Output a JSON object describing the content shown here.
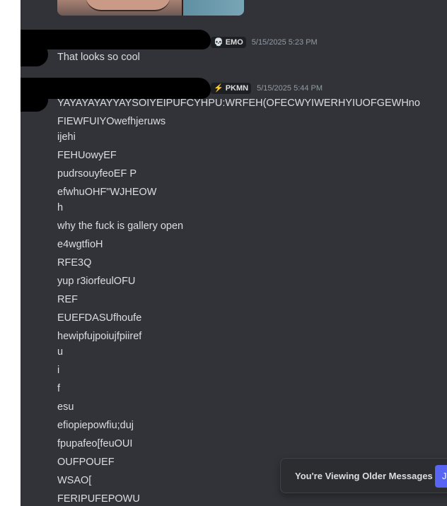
{
  "messages": [
    {
      "role_badge": {
        "icon": "skull-icon",
        "icon_glyph": "💀",
        "label": "EMO"
      },
      "timestamp": "5/15/2025 5:23 PM",
      "lines": [
        "That looks so cool"
      ]
    },
    {
      "role_badge": {
        "icon": "lightning-icon",
        "icon_glyph": "⚡",
        "label": "PKMN"
      },
      "timestamp": "5/15/2025 5:44 PM",
      "lines": [
        "YAYAYAYAYYAYSOIYEIPUFCYHPU:WRFEH(OFECWYIWERHYIUOFGEWHno",
        "FIEWFUIYOwefhjeruws",
        "ijehi",
        "FEHUowyEF",
        "pudrsouyfeoEF P",
        "efwhuOHF\"WJHEOW",
        "h",
        "why the fuck is gallery open",
        "e4wgtfioH",
        "RFE3Q",
        "yup r3iorfeulOFU",
        "REF",
        "EUEFDASUfhoufe",
        "hewipfujpoiujfpiiref",
        "u",
        "i",
        "f",
        "esu",
        "efiopiepowfiu;duj",
        "fpupafeo[feuOUI",
        "OUFPOUEF",
        "WSAO[",
        "FERIPUFEPOWU"
      ]
    }
  ],
  "older_messages_bar": {
    "text": "You're Viewing Older Messages",
    "jump_label": "J"
  },
  "colors": {
    "background": "#313338",
    "text": "#dbdee1",
    "muted": "#949ba4",
    "accent": "#5865f2"
  }
}
